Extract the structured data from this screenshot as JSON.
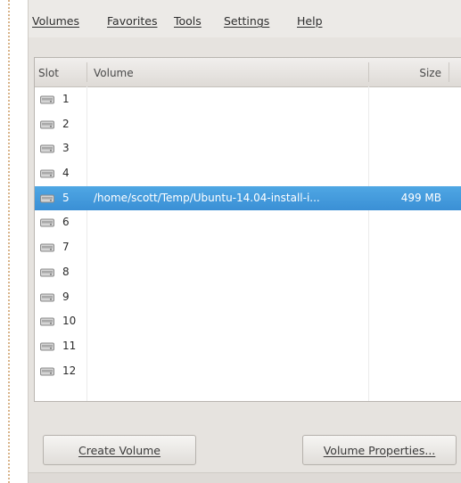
{
  "menubar": {
    "items": [
      {
        "label": "Volumes"
      },
      {
        "label": "Favorites"
      },
      {
        "label": "Tools"
      },
      {
        "label": "Settings"
      },
      {
        "label": "Help"
      }
    ]
  },
  "table": {
    "columns": [
      {
        "label": "Slot"
      },
      {
        "label": "Volume"
      },
      {
        "label": "Size"
      }
    ],
    "rows": [
      {
        "slot": "1",
        "volume": "",
        "size": ""
      },
      {
        "slot": "2",
        "volume": "",
        "size": ""
      },
      {
        "slot": "3",
        "volume": "",
        "size": ""
      },
      {
        "slot": "4",
        "volume": "",
        "size": ""
      },
      {
        "slot": "5",
        "volume": "/home/scott/Temp/Ubuntu-14.04-install-i...",
        "size": "499 MB"
      },
      {
        "slot": "6",
        "volume": "",
        "size": ""
      },
      {
        "slot": "7",
        "volume": "",
        "size": ""
      },
      {
        "slot": "8",
        "volume": "",
        "size": ""
      },
      {
        "slot": "9",
        "volume": "",
        "size": ""
      },
      {
        "slot": "10",
        "volume": "",
        "size": ""
      },
      {
        "slot": "11",
        "volume": "",
        "size": ""
      },
      {
        "slot": "12",
        "volume": "",
        "size": ""
      }
    ],
    "selected_slot": "5",
    "drive_icon": "hard-drive-icon"
  },
  "buttons": {
    "create_volume": "Create Volume",
    "volume_properties": "Volume Properties..."
  },
  "colors": {
    "selection": "#3a8fd5",
    "window_bg": "#e6e3df"
  }
}
